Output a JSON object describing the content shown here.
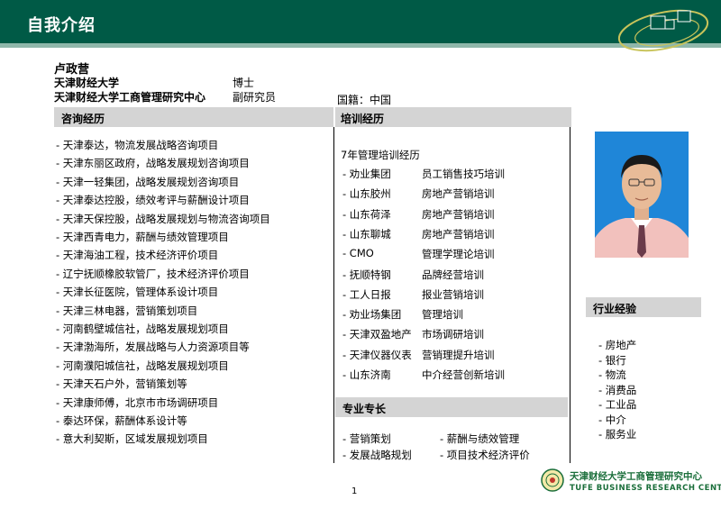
{
  "title": "自我介绍",
  "person": {
    "name": "卢政营",
    "line1_org": "天津财经大学",
    "line1_title": "博士",
    "line2_org": "天津财经大学工商管理研究中心",
    "line2_title": "副研究员",
    "nationality": "国籍：中国"
  },
  "consulting": {
    "heading": "咨询经历",
    "items": [
      "- 天津泰达，物流发展战略咨询项目",
      "- 天津东丽区政府，战略发展规划咨询项目",
      "- 天津一轻集团，战略发展规划咨询项目",
      "- 天津泰达控股，绩效考评与薪酬设计项目",
      "- 天津天保控股，战略发展规划与物流咨询项目",
      "- 天津西青电力，薪酬与绩效管理项目",
      "- 天津海油工程，技术经济评价项目",
      "- 辽宁抚顺橡胶软管厂，技术经济评价项目",
      "- 天津长征医院，管理体系设计项目",
      "- 天津三林电器，营销策划项目",
      "- 河南鹤壁城信社，战略发展规划项目",
      "- 天津渤海所，发展战略与人力资源项目等",
      "- 河南濮阳城信社，战略发展规划项目",
      "- 天津天石户外，营销策划等",
      "- 天津康师傅，北京市市场调研项目",
      "- 泰达环保，薪酬体系设计等",
      "- 意大利契斯，区域发展规划项目"
    ]
  },
  "training": {
    "heading": "培训经历",
    "intro": "7年管理培训经历",
    "items": [
      {
        "org": "- 劝业集团",
        "course": "员工销售技巧培训"
      },
      {
        "org": "- 山东胶州",
        "course": "房地产营销培训"
      },
      {
        "org": "- 山东荷泽",
        "course": "房地产营销培训"
      },
      {
        "org": "- 山东聊城",
        "course": "房地产营销培训"
      },
      {
        "org": "- CMO",
        "course": "管理学理论培训"
      },
      {
        "org": "- 抚顺特钢",
        "course": "品牌经营培训"
      },
      {
        "org": "- 工人日报",
        "course": "报业营销培训"
      },
      {
        "org": "- 劝业场集团",
        "course": "管理培训"
      },
      {
        "org": "- 天津双盈地产",
        "course": "市场调研培训"
      },
      {
        "org": "- 天津仪器仪表",
        "course": "营销理提升培训"
      },
      {
        "org": "- 山东济南",
        "course": "中介经营创新培训"
      }
    ]
  },
  "expertise": {
    "heading": "专业专长",
    "items": [
      "- 营销策划",
      "- 薪酬与绩效管理",
      "- 发展战略规划",
      "- 项目技术经济评价"
    ]
  },
  "industry": {
    "heading": "行业经验",
    "items": [
      "- 房地产",
      "- 银行",
      "- 物流",
      "- 消费品",
      "- 工业品",
      "- 中介",
      "- 服务业"
    ]
  },
  "page_number": "1",
  "footer": {
    "logo_cn": "天津财经大学工商管理研究中心",
    "logo_en": "TUFE BUSINESS RESEARCH CENTER"
  },
  "colors": {
    "header_bg": "#005a46",
    "band_bg": "#d4d4d4",
    "logo_text": "#1a6e3a"
  }
}
